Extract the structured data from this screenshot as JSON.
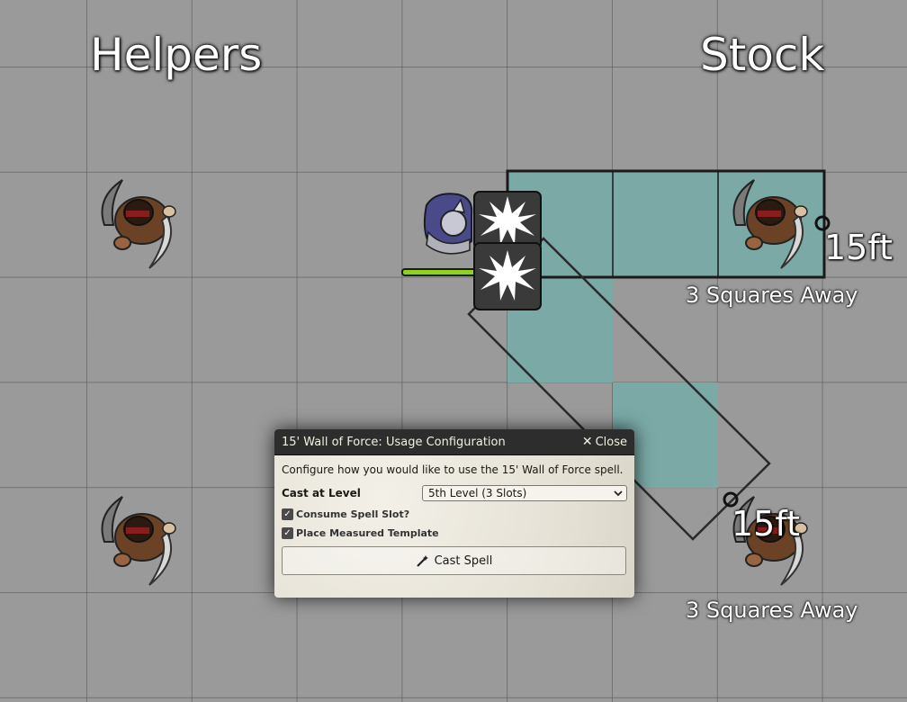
{
  "map": {
    "labels": {
      "left": "Helpers",
      "right": "Stock"
    },
    "measurements": [
      {
        "distance": "15ft",
        "squares": "3 Squares Away"
      },
      {
        "distance": "15ft",
        "squares": "3 Squares Away"
      }
    ],
    "colors": {
      "template_fill": "#7aa9a6",
      "health_bar": "#8fd11e",
      "grid_background": "#9a9a9a"
    },
    "icons": [
      "bandit-token",
      "caster-token",
      "burst-effect-icon",
      "measure-origin-icon"
    ]
  },
  "dialog": {
    "title": "15' Wall of Force: Usage Configuration",
    "close_label": "Close",
    "intro": "Configure how you would like to use the 15' Wall of Force spell.",
    "cast_level_label": "Cast at Level",
    "cast_level_value": "5th Level (3 Slots)",
    "consume_slot_label": "Consume Spell Slot?",
    "consume_slot_checked": true,
    "place_template_label": "Place Measured Template",
    "place_template_checked": true,
    "cast_button_label": "Cast Spell"
  }
}
